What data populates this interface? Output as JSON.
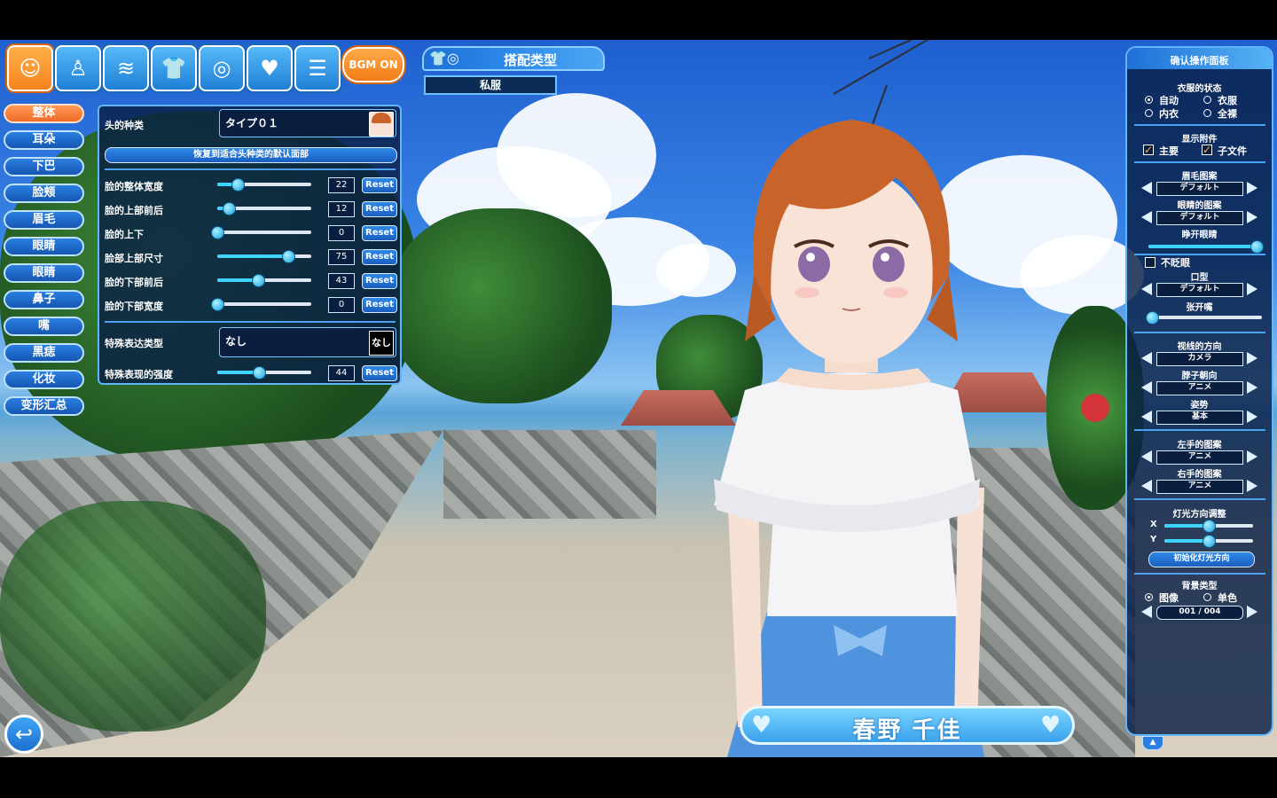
{
  "top_icons": [
    {
      "icon": "smiley-face-icon",
      "glyph": "☺"
    },
    {
      "icon": "body-figure-icon",
      "glyph": "🚹"
    },
    {
      "icon": "hair-icon",
      "glyph": "≈"
    },
    {
      "icon": "clothes-icon",
      "glyph": "👕"
    },
    {
      "icon": "ring-accessory-icon",
      "glyph": "💍"
    },
    {
      "icon": "heart-icon",
      "glyph": "♥"
    },
    {
      "icon": "menu-list-icon",
      "glyph": "☰"
    }
  ],
  "bgm_label": "BGM ON",
  "outfit": {
    "title": "搭配类型",
    "value": "私服"
  },
  "left_nav": [
    "整体",
    "耳朵",
    "下巴",
    "脸颊",
    "眉毛",
    "眼睛",
    "眼睛",
    "鼻子",
    "嘴",
    "黑痣",
    "化妆",
    "变形汇总"
  ],
  "face_panel": {
    "head_type_label": "头的种类",
    "head_type_value": "タイプ０１",
    "restore_button": "恢复到适合头种类的默认面部",
    "reset_label": "Reset",
    "sliders": [
      {
        "label": "脸的整体宽度",
        "value": 22
      },
      {
        "label": "脸的上部前后",
        "value": 12
      },
      {
        "label": "脸的上下",
        "value": 0
      },
      {
        "label": "脸部上部尺寸",
        "value": 75
      },
      {
        "label": "脸的下部前后",
        "value": 43
      },
      {
        "label": "脸的下部宽度",
        "value": 0
      }
    ],
    "expression_type_label": "特殊表达类型",
    "expression_type_value": "なし",
    "expression_type_thumb": "なし",
    "expression_strength_label": "特殊表现的强度",
    "expression_strength_value": 44
  },
  "right_panel": {
    "title": "确认操作面板",
    "clothing_state_title": "衣服的状态",
    "clothing_state": {
      "auto": "自动",
      "clothes": "衣服",
      "underwear": "内衣",
      "nude": "全裸"
    },
    "display_accessory_title": "显示附件",
    "display_accessory": {
      "main": "主要",
      "sub": "子文件"
    },
    "eyebrow_pattern_title": "眉毛图案",
    "eyebrow_pattern": "デフォルト",
    "eye_pattern_title": "眼睛的图案",
    "eye_pattern": "デフォルト",
    "eye_open_title": "睁开眼睛",
    "eye_open_level": 0.95,
    "no_blink_label": "不眨眼",
    "mouth_title": "口型",
    "mouth": "デフォルト",
    "mouth_open_title": "张开嘴",
    "mouth_open_level": 0.0,
    "gaze_title": "视线的方向",
    "gaze": "カメラ",
    "neck_title": "脖子朝向",
    "neck": "アニメ",
    "pose_title": "姿势",
    "pose": "基本",
    "left_hand_title": "左手的图案",
    "left_hand": "アニメ",
    "right_hand_title": "右手的图案",
    "right_hand": "アニメ",
    "light_title": "灯光方向调整",
    "light_x_label": "X",
    "light_y_label": "Y",
    "light_x_level": 0.5,
    "light_y_level": 0.5,
    "light_reset": "初始化灯光方向",
    "bg_title": "背景类型",
    "bg_options": {
      "image": "图像",
      "solid": "单色"
    },
    "bg_value": "001 / 004"
  },
  "character_name": "春野 千佳",
  "colors": {
    "accent": "#2a7fe0",
    "active": "#f5831e",
    "panel_border": "#5fb6ff"
  }
}
